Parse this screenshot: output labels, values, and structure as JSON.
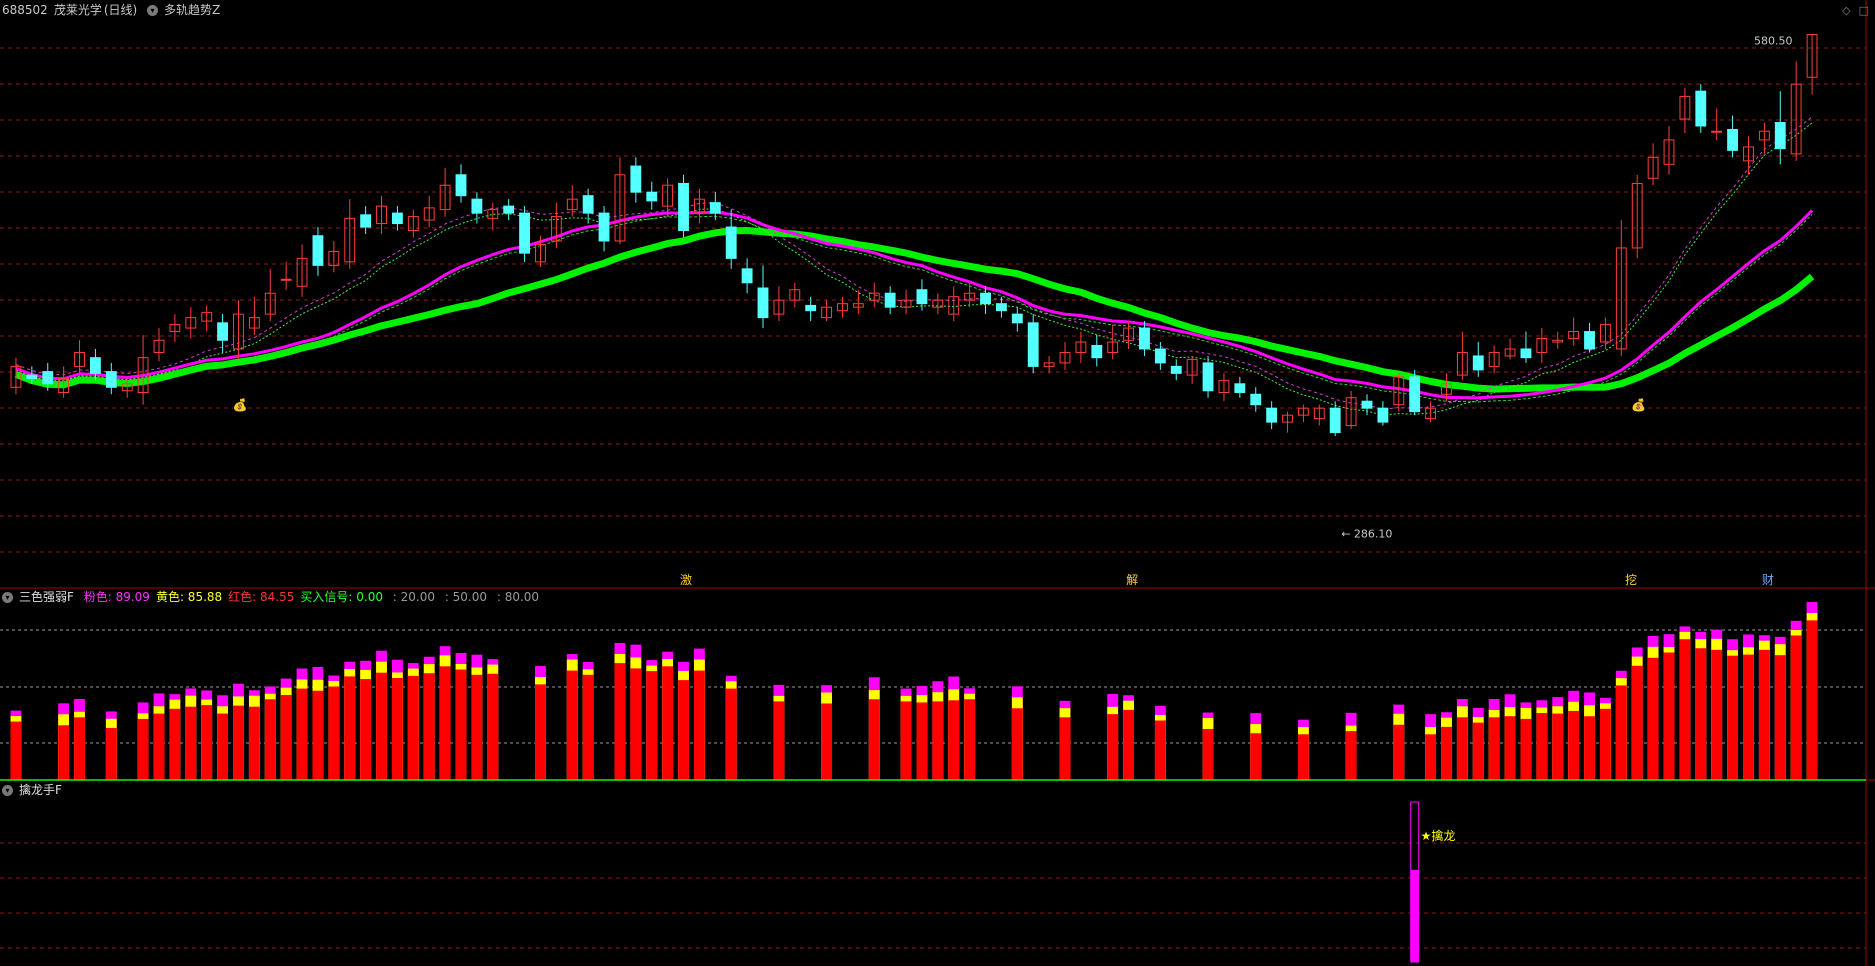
{
  "main": {
    "symbol": "688502",
    "name": "茂莱光学",
    "period": "(日线)",
    "indicator": "多轨趋势Z",
    "high_label": "580.50",
    "low_label": "286.10",
    "event_markers": [
      "激",
      "解",
      "挖",
      "财"
    ]
  },
  "panel2": {
    "name": "三色强弱F",
    "values": [
      {
        "label": "粉色:",
        "value": "89.09",
        "color": "#ff33ff"
      },
      {
        "label": "黄色:",
        "value": "85.88",
        "color": "#ffff33"
      },
      {
        "label": "红色:",
        "value": "84.55",
        "color": "#ff3333"
      },
      {
        "label": "买入信号:",
        "value": "0.00",
        "color": "#33ff33"
      },
      {
        "label": "",
        "value": ": 20.00",
        "color": "#9a9a9a"
      },
      {
        "label": "",
        "value": ": 50.00",
        "color": "#9a9a9a"
      },
      {
        "label": "",
        "value": ": 80.00",
        "color": "#9a9a9a"
      }
    ]
  },
  "panel3": {
    "name": "擒龙手F",
    "signal_label": "擒龙"
  },
  "colors": {
    "up": "#ff3c3c",
    "down": "#54ffff",
    "green": "#00ff00",
    "magenta": "#ff00ff",
    "yellow": "#ffff00",
    "red": "#ff0000",
    "grid": "#8b1a1a"
  },
  "chart_data": {
    "type": "candlestick",
    "x": [
      0,
      1,
      2,
      3,
      4,
      5,
      6,
      7,
      8,
      9,
      10,
      11,
      12,
      13,
      14,
      15,
      16,
      17,
      18,
      19,
      20,
      21,
      22,
      23,
      24,
      25,
      26,
      27,
      28,
      29,
      30,
      31,
      32,
      33,
      34,
      35,
      36,
      37,
      38,
      39,
      40,
      41,
      42,
      43,
      44,
      45,
      46,
      47,
      48,
      49,
      50,
      51,
      52,
      53,
      54,
      55,
      56,
      57,
      58,
      59,
      60,
      61,
      62,
      63,
      64,
      65,
      66,
      67,
      68,
      69,
      70,
      71,
      72,
      73,
      74,
      75,
      76,
      77,
      78,
      79,
      80,
      81,
      82,
      83,
      84,
      85,
      86,
      87,
      88,
      89,
      90,
      91,
      92,
      93,
      94,
      95,
      96,
      97,
      98,
      99,
      100,
      101,
      102,
      103
    ],
    "candles": [
      [
        378,
        390,
        395,
        374
      ],
      [
        385,
        383,
        390,
        380
      ],
      [
        387,
        380,
        392,
        376
      ],
      [
        375,
        383,
        390,
        372
      ],
      [
        390,
        398,
        405,
        385
      ],
      [
        395,
        386,
        400,
        382
      ],
      [
        387,
        378,
        392,
        374
      ],
      [
        376,
        380,
        384,
        372
      ],
      [
        375,
        395,
        408,
        368
      ],
      [
        398,
        405,
        412,
        393
      ],
      [
        410,
        414,
        420,
        404
      ],
      [
        412,
        418,
        424,
        406
      ],
      [
        416,
        421,
        425,
        410
      ],
      [
        415,
        405,
        420,
        398
      ],
      [
        400,
        420,
        428,
        394
      ],
      [
        412,
        418,
        430,
        408
      ],
      [
        420,
        432,
        446,
        416
      ],
      [
        440,
        440,
        450,
        434
      ],
      [
        436,
        452,
        460,
        430
      ],
      [
        465,
        448,
        470,
        442
      ],
      [
        448,
        456,
        462,
        444
      ],
      [
        450,
        475,
        486,
        446
      ],
      [
        477,
        470,
        482,
        466
      ],
      [
        472,
        482,
        488,
        466
      ],
      [
        478,
        472,
        482,
        468
      ],
      [
        468,
        476,
        480,
        464
      ],
      [
        474,
        481,
        488,
        470
      ],
      [
        480,
        494,
        504,
        476
      ],
      [
        500,
        488,
        506,
        484
      ],
      [
        486,
        478,
        490,
        472
      ],
      [
        475,
        480,
        484,
        468
      ],
      [
        482,
        478,
        486,
        474
      ],
      [
        478,
        455,
        482,
        450
      ],
      [
        450,
        460,
        465,
        447
      ],
      [
        462,
        476,
        484,
        458
      ],
      [
        480,
        486,
        494,
        476
      ],
      [
        488,
        478,
        492,
        472
      ],
      [
        478,
        462,
        482,
        456
      ],
      [
        462,
        500,
        510,
        460
      ],
      [
        505,
        490,
        510,
        484
      ],
      [
        490,
        485,
        496,
        480
      ],
      [
        482,
        494,
        498,
        476
      ],
      [
        495,
        468,
        500,
        464
      ],
      [
        478,
        486,
        492,
        472
      ],
      [
        484,
        478,
        490,
        474
      ],
      [
        470,
        452,
        480,
        446
      ],
      [
        446,
        438,
        452,
        432
      ],
      [
        435,
        418,
        448,
        412
      ],
      [
        420,
        428,
        436,
        416
      ],
      [
        428,
        434,
        438,
        424
      ],
      [
        425,
        422,
        430,
        416
      ],
      [
        418,
        424,
        428,
        416
      ],
      [
        422,
        426,
        430,
        418
      ],
      [
        424,
        426,
        434,
        420
      ],
      [
        428,
        432,
        438,
        424
      ],
      [
        432,
        424,
        436,
        420
      ],
      [
        424,
        428,
        434,
        420
      ],
      [
        434,
        426,
        440,
        422
      ],
      [
        424,
        428,
        432,
        420
      ],
      [
        420,
        430,
        436,
        416
      ],
      [
        428,
        432,
        438,
        424
      ],
      [
        432,
        426,
        436,
        420
      ],
      [
        426,
        422,
        430,
        418
      ],
      [
        420,
        415,
        424,
        410
      ],
      [
        415,
        390,
        420,
        386
      ],
      [
        390,
        392,
        396,
        386
      ],
      [
        392,
        398,
        404,
        388
      ],
      [
        398,
        404,
        410,
        392
      ],
      [
        402,
        395,
        408,
        390
      ],
      [
        398,
        404,
        414,
        394
      ],
      [
        405,
        412,
        416,
        400
      ],
      [
        412,
        400,
        416,
        396
      ],
      [
        400,
        392,
        404,
        388
      ],
      [
        390,
        386,
        394,
        382
      ],
      [
        385,
        394,
        396,
        380
      ],
      [
        392,
        376,
        396,
        372
      ],
      [
        375,
        382,
        386,
        370
      ],
      [
        380,
        375,
        384,
        372
      ],
      [
        374,
        368,
        378,
        364
      ],
      [
        366,
        358,
        370,
        354
      ],
      [
        358,
        362,
        364,
        352
      ],
      [
        362,
        366,
        368,
        358
      ],
      [
        360,
        366,
        368,
        356
      ],
      [
        366,
        352,
        370,
        350
      ],
      [
        356,
        372,
        376,
        354
      ],
      [
        370,
        366,
        374,
        362
      ],
      [
        366,
        358,
        370,
        356
      ],
      [
        368,
        384,
        386,
        364
      ],
      [
        384,
        364,
        388,
        362
      ],
      [
        360,
        366,
        370,
        358
      ],
      [
        374,
        380,
        386,
        370
      ],
      [
        385,
        398,
        410,
        382
      ],
      [
        396,
        388,
        404,
        384
      ],
      [
        390,
        398,
        402,
        386
      ],
      [
        396,
        400,
        406,
        394
      ],
      [
        400,
        395,
        410,
        392
      ],
      [
        398,
        406,
        412,
        392
      ],
      [
        404,
        405,
        410,
        400
      ],
      [
        406,
        410,
        418,
        402
      ],
      [
        410,
        400,
        415,
        398
      ],
      [
        404,
        414,
        418,
        400
      ],
      [
        400,
        458,
        474,
        396
      ],
      [
        458,
        495,
        500,
        452
      ],
      [
        498,
        510,
        518,
        494
      ]
    ],
    "tail": [
      [
        506,
        520,
        528,
        500
      ],
      [
        532,
        545,
        550,
        524
      ],
      [
        548,
        528,
        552,
        524
      ],
      [
        525,
        525,
        538,
        520
      ],
      [
        526,
        514,
        534,
        510
      ],
      [
        508,
        516,
        522,
        500
      ],
      [
        520,
        525,
        530,
        512
      ],
      [
        530,
        515,
        548,
        506
      ],
      [
        512,
        552,
        565,
        508
      ],
      [
        556,
        580.5,
        580.5,
        546
      ]
    ],
    "high": 580.5,
    "low": 286.1,
    "ylim": [
      280,
      590
    ]
  }
}
